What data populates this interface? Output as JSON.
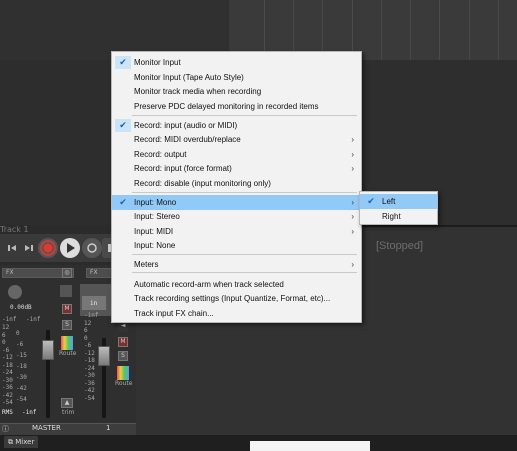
{
  "background": {
    "status_text": "[Stopped]",
    "track_label": "Track 1"
  },
  "mixer": {
    "fx_label_master": "FX",
    "fx_label_track": "FX",
    "master_db": "0.00dB",
    "master_peak_l": "-inf",
    "master_peak_r": "-inf",
    "rms_label": "RMS",
    "rms_value": "-inf",
    "route_label": "Route",
    "trim_label": "trim",
    "master_label": "MASTER",
    "track_number": "1",
    "in_label": "in",
    "mute_label": "M",
    "solo_label": "S",
    "scale": [
      "12",
      "6",
      "0",
      "-6",
      "-12",
      "-18",
      "-24",
      "-30",
      "-36",
      "-42",
      "-54"
    ],
    "scale_mid": [
      "0",
      "-6",
      "-15",
      "-18",
      "-30",
      "-42",
      "-54"
    ],
    "scale_right": [
      "-inf",
      "12",
      "6",
      "0",
      "-6",
      "-12",
      "-18",
      "-24",
      "-30",
      "-36",
      "-42",
      "-54"
    ],
    "tab_label": "Mixer"
  },
  "menu": {
    "items": [
      {
        "label": "Monitor Input",
        "checked": true,
        "submenu": false
      },
      {
        "label": "Monitor Input (Tape Auto Style)",
        "checked": false,
        "submenu": false
      },
      {
        "label": "Monitor track media when recording",
        "checked": false,
        "submenu": false
      },
      {
        "label": "Preserve PDC delayed monitoring in recorded items",
        "checked": false,
        "submenu": false
      },
      {
        "label": "Record: input (audio or MIDI)",
        "checked": true,
        "submenu": false
      },
      {
        "label": "Record: MIDI overdub/replace",
        "checked": false,
        "submenu": true
      },
      {
        "label": "Record: output",
        "checked": false,
        "submenu": true
      },
      {
        "label": "Record: input (force format)",
        "checked": false,
        "submenu": true
      },
      {
        "label": "Record: disable (input monitoring only)",
        "checked": false,
        "submenu": false
      },
      {
        "label": "Input: Mono",
        "checked": true,
        "submenu": true
      },
      {
        "label": "Input: Stereo",
        "checked": false,
        "submenu": true
      },
      {
        "label": "Input: MIDI",
        "checked": false,
        "submenu": true
      },
      {
        "label": "Input: None",
        "checked": false,
        "submenu": false
      },
      {
        "label": "Meters",
        "checked": false,
        "submenu": true
      },
      {
        "label": "Automatic record-arm when track selected",
        "checked": false,
        "submenu": false
      },
      {
        "label": "Track recording settings (Input Quantize, Format, etc)...",
        "checked": false,
        "submenu": false
      },
      {
        "label": "Track input FX chain...",
        "checked": false,
        "submenu": false
      }
    ],
    "check_glyph": "✔",
    "arrow_glyph": "›"
  },
  "submenu": {
    "items": [
      {
        "label": "Left",
        "checked": true
      },
      {
        "label": "Right",
        "checked": false
      }
    ]
  },
  "colors": {
    "menu_bg": "#f2f2f2",
    "highlight": "#91c9f7",
    "check_bg": "#cce4f7",
    "record_red": "#e0372f"
  }
}
